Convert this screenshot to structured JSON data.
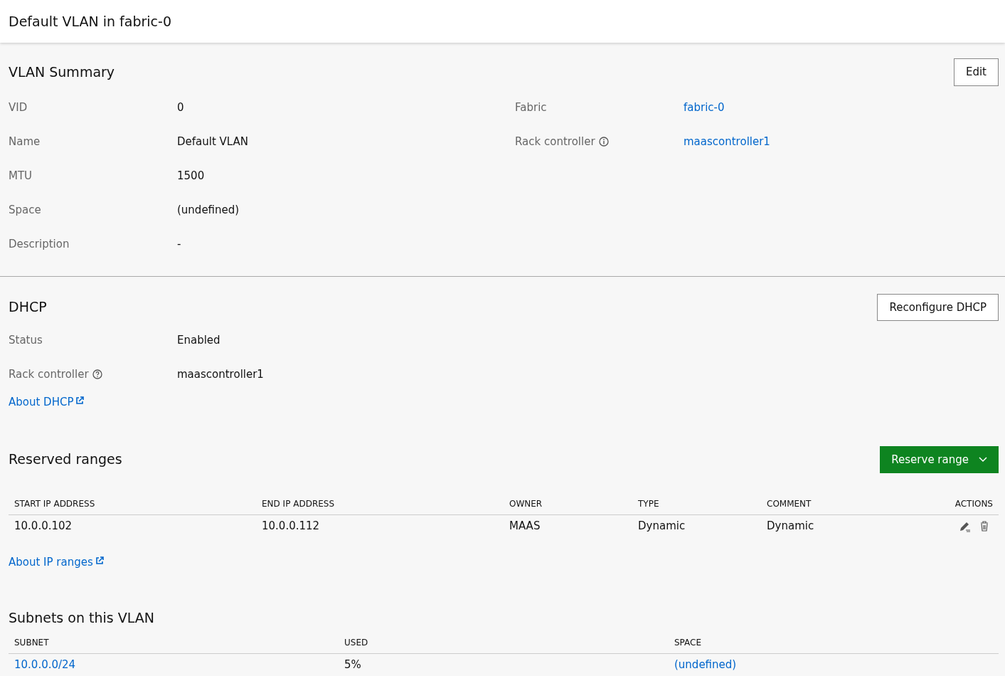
{
  "header": {
    "title": "Default VLAN in fabric-0"
  },
  "summary": {
    "title": "VLAN Summary",
    "edit_button": "Edit",
    "left": [
      {
        "label": "VID",
        "value": "0"
      },
      {
        "label": "Name",
        "value": "Default VLAN"
      },
      {
        "label": "MTU",
        "value": "1500"
      },
      {
        "label": "Space",
        "value": "(undefined)"
      },
      {
        "label": "Description",
        "value": "-"
      }
    ],
    "right": [
      {
        "kind": "plain",
        "label": "Fabric",
        "value": "fabric-0",
        "link": true
      },
      {
        "kind": "info",
        "label": "Rack controller",
        "value": "maascontroller1",
        "link": true
      }
    ]
  },
  "dhcp": {
    "title": "DHCP",
    "button": "Reconfigure DHCP",
    "rows": [
      {
        "kind": "plain",
        "label": "Status",
        "value": "Enabled"
      },
      {
        "kind": "help",
        "label": "Rack controller",
        "value": "maascontroller1"
      }
    ],
    "about_link": "About DHCP"
  },
  "reserved": {
    "title": "Reserved ranges",
    "button": "Reserve range",
    "columns": [
      "START IP ADDRESS",
      "END IP ADDRESS",
      "OWNER",
      "TYPE",
      "COMMENT",
      "ACTIONS"
    ],
    "rows": [
      [
        "10.0.0.102",
        "10.0.0.112",
        "MAAS",
        "Dynamic",
        "Dynamic"
      ]
    ],
    "about_link": "About IP ranges"
  },
  "subnets": {
    "title": "Subnets on this VLAN",
    "columns": [
      "SUBNET",
      "USED",
      "SPACE"
    ],
    "rows": [
      [
        {
          "text": "10.0.0.0/24",
          "link": true
        },
        {
          "text": "5%",
          "link": false
        },
        {
          "text": "(undefined)",
          "link": true
        }
      ]
    ]
  }
}
